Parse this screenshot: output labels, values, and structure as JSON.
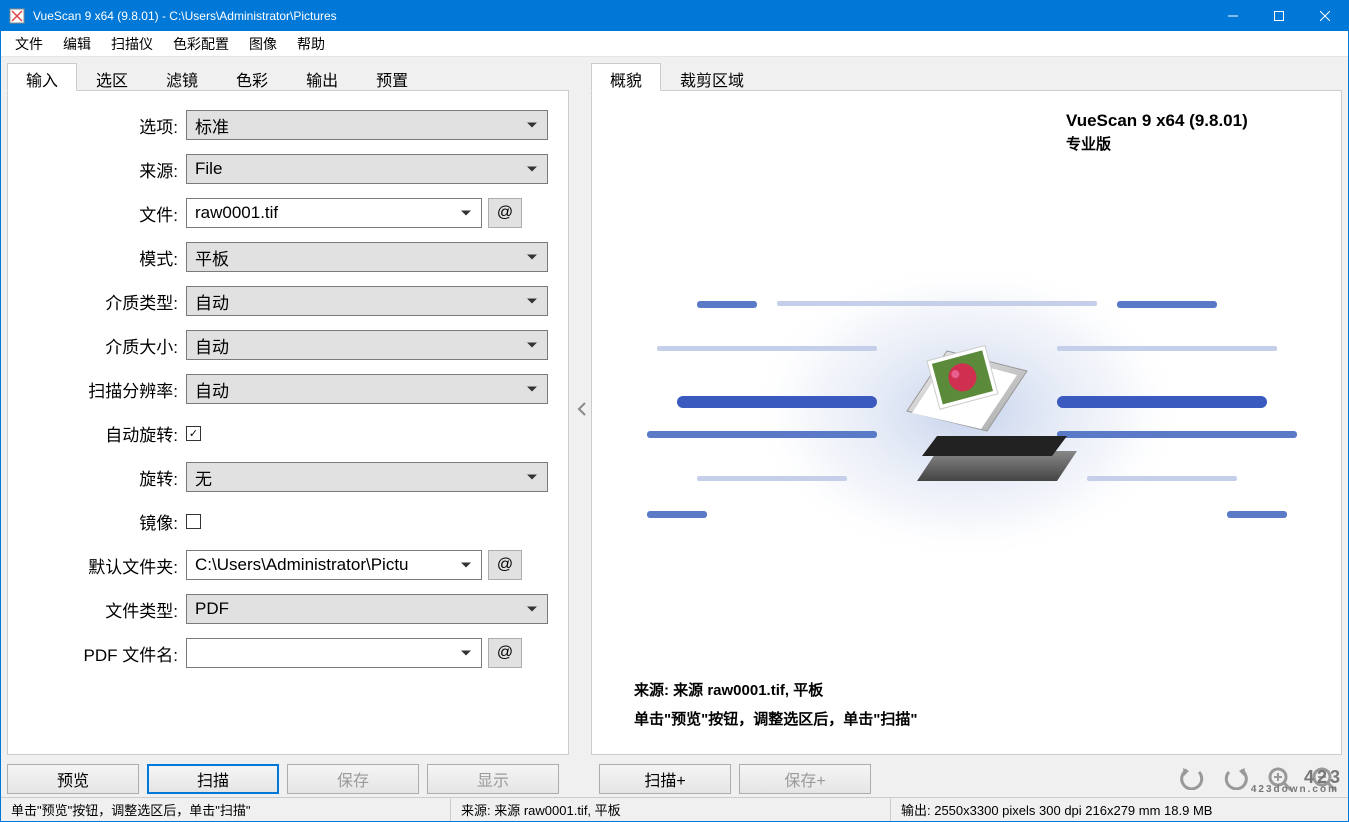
{
  "titlebar": {
    "title": "VueScan 9 x64 (9.8.01) - C:\\Users\\Administrator\\Pictures"
  },
  "menubar": [
    "文件",
    "编辑",
    "扫描仪",
    "色彩配置",
    "图像",
    "帮助"
  ],
  "left_tabs": [
    "输入",
    "选区",
    "滤镜",
    "色彩",
    "输出",
    "预置"
  ],
  "right_tabs": [
    "概貌",
    "裁剪区域"
  ],
  "form": {
    "options_label": "选项:",
    "options_value": "标准",
    "source_label": "来源:",
    "source_value": "File",
    "file_label": "文件:",
    "file_value": "raw0001.tif",
    "mode_label": "模式:",
    "mode_value": "平板",
    "media_type_label": "介质类型:",
    "media_type_value": "自动",
    "media_size_label": "介质大小:",
    "media_size_value": "自动",
    "resolution_label": "扫描分辨率:",
    "resolution_value": "自动",
    "auto_rotate_label": "自动旋转:",
    "auto_rotate_checked": true,
    "rotate_label": "旋转:",
    "rotate_value": "无",
    "mirror_label": "镜像:",
    "mirror_checked": false,
    "default_folder_label": "默认文件夹:",
    "default_folder_value": "C:\\Users\\Administrator\\Pictu",
    "file_type_label": "文件类型:",
    "file_type_value": "PDF",
    "pdf_name_label": "PDF 文件名:",
    "pdf_name_value": ""
  },
  "preview": {
    "title": "VueScan 9 x64 (9.8.01)",
    "subtitle": "专业版",
    "info1": "来源: 来源 raw0001.tif, 平板",
    "info2": "单击\"预览\"按钮，调整选区后，单击\"扫描\""
  },
  "buttons": {
    "preview": "预览",
    "scan": "扫描",
    "save": "保存",
    "show": "显示",
    "scan_plus": "扫描+",
    "save_plus": "保存+"
  },
  "statusbar": {
    "left": "单击\"预览\"按钮，调整选区后，单击\"扫描\"",
    "center": "来源: 来源 raw0001.tif, 平板",
    "right": "输出: 2550x3300 pixels 300 dpi 216x279 mm 18.9 MB"
  },
  "at_symbol": "@",
  "watermark": {
    "top": "4 2 3",
    "bottom": "423down.com"
  }
}
